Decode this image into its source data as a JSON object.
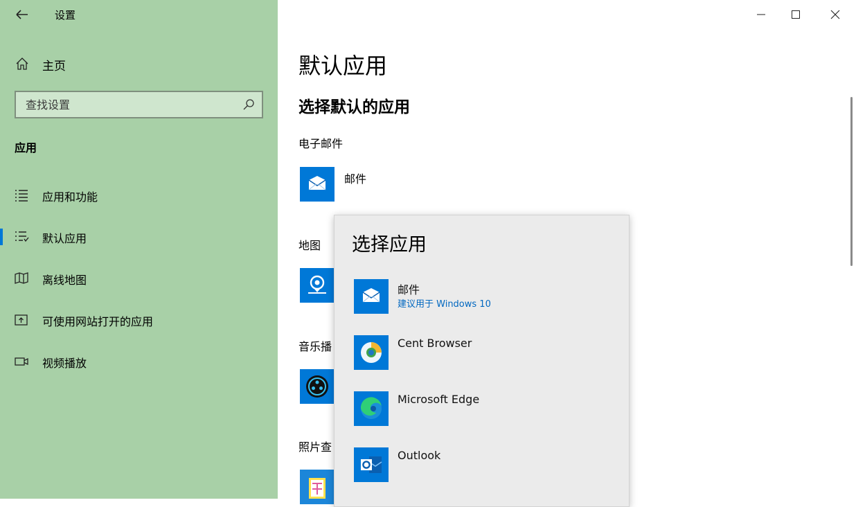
{
  "window": {
    "title": "设置"
  },
  "sidebar": {
    "home_label": "主页",
    "search_placeholder": "查找设置",
    "section_label": "应用",
    "items": [
      {
        "label": "应用和功能",
        "icon": "list-icon"
      },
      {
        "label": "默认应用",
        "icon": "default-apps-icon",
        "selected": true
      },
      {
        "label": "离线地图",
        "icon": "map-icon"
      },
      {
        "label": "可使用网站打开的应用",
        "icon": "open-website-icon"
      },
      {
        "label": "视频播放",
        "icon": "video-icon"
      }
    ]
  },
  "main": {
    "title": "默认应用",
    "subtitle": "选择默认的应用",
    "categories": [
      {
        "label": "电子邮件",
        "app": "邮件"
      },
      {
        "label": "地图"
      },
      {
        "label": "音乐播"
      },
      {
        "label": "照片查"
      }
    ]
  },
  "flyout": {
    "title": "选择应用",
    "items": [
      {
        "name": "邮件",
        "note": "建议用于 Windows 10",
        "icon": "mail-icon"
      },
      {
        "name": "Cent Browser",
        "icon": "cent-browser-icon"
      },
      {
        "name": "Microsoft Edge",
        "icon": "edge-icon"
      },
      {
        "name": "Outlook",
        "icon": "outlook-icon"
      }
    ]
  },
  "colors": {
    "sidebar_bg": "#a8d0a7",
    "accent": "#0078d7",
    "flyout_bg": "#ebebeb",
    "note_link": "#0067c0"
  }
}
